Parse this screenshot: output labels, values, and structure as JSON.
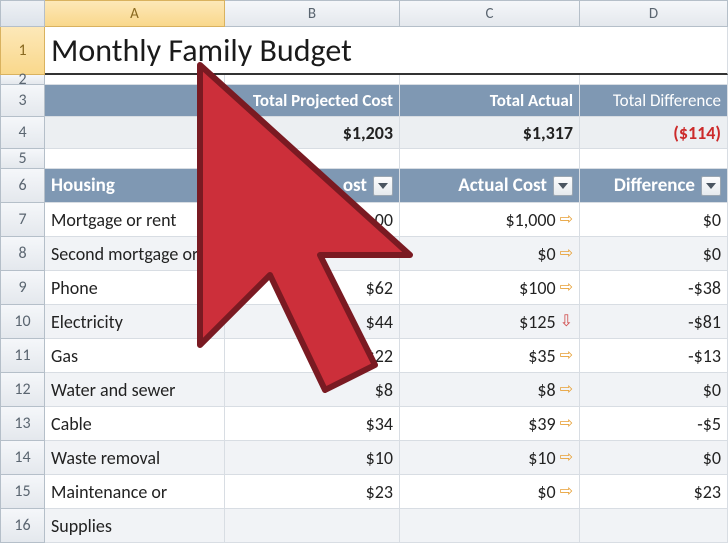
{
  "columns": [
    "A",
    "B",
    "C",
    "D"
  ],
  "row_labels": [
    "1",
    "2",
    "3",
    "4",
    "5",
    "6",
    "7",
    "8",
    "9",
    "10",
    "11",
    "12",
    "13",
    "14",
    "15",
    "16"
  ],
  "title": "Monthly Family Budget",
  "totals_header": {
    "projected": "Total Projected Cost",
    "actual": "Total Actual",
    "difference": "Total Difference"
  },
  "totals": {
    "projected": "$1,203",
    "actual": "$1,317",
    "difference": "($114)"
  },
  "section": {
    "name": "Housing",
    "col_cost": "ost",
    "col_actual": "Actual Cost",
    "col_diff": "Difference"
  },
  "rows": [
    {
      "label": "Mortgage or rent",
      "cost": "00",
      "actual": "$1,000",
      "diff": "$0",
      "arrow": "right"
    },
    {
      "label": "Second mortgage or",
      "cost": "",
      "actual": "$0",
      "diff": "$0",
      "arrow": "right"
    },
    {
      "label": "Phone",
      "cost": "$62",
      "actual": "$100",
      "diff": "-$38",
      "arrow": "right"
    },
    {
      "label": "Electricity",
      "cost": "$44",
      "actual": "$125",
      "diff": "-$81",
      "arrow": "down"
    },
    {
      "label": "Gas",
      "cost": "$22",
      "actual": "$35",
      "diff": "-$13",
      "arrow": "right"
    },
    {
      "label": "Water and sewer",
      "cost": "$8",
      "actual": "$8",
      "diff": "$0",
      "arrow": "right"
    },
    {
      "label": "Cable",
      "cost": "$34",
      "actual": "$39",
      "diff": "-$5",
      "arrow": "right"
    },
    {
      "label": "Waste removal",
      "cost": "$10",
      "actual": "$10",
      "diff": "$0",
      "arrow": "right"
    },
    {
      "label": "Maintenance or",
      "cost": "$23",
      "actual": "$0",
      "diff": "$23",
      "arrow": "right"
    },
    {
      "label": "Supplies",
      "cost": "",
      "actual": "",
      "diff": "",
      "arrow": ""
    }
  ]
}
